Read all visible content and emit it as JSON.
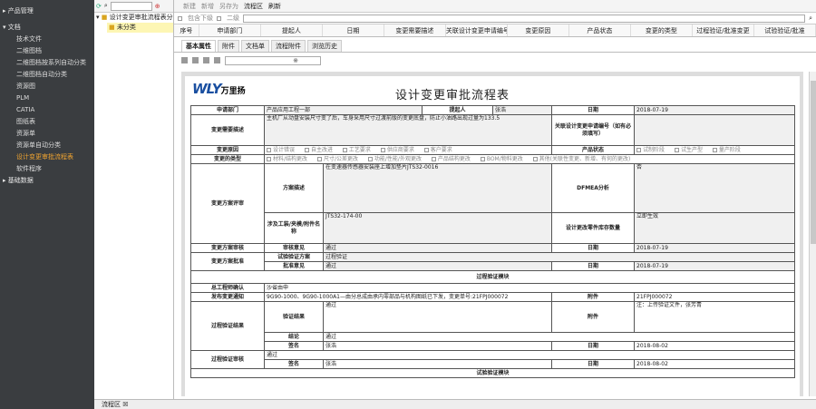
{
  "sidebar": {
    "items": [
      {
        "label": "▸ 产品管理"
      },
      {
        "label": "▾ 文档"
      },
      {
        "label": "技术文件"
      },
      {
        "label": "二维图档"
      },
      {
        "label": "二维图档按系列自动分类"
      },
      {
        "label": "二维图档自动分类"
      },
      {
        "label": "资源图"
      },
      {
        "label": "PLM"
      },
      {
        "label": "CATIA"
      },
      {
        "label": "图纸表"
      },
      {
        "label": "资源单"
      },
      {
        "label": "资源单自动分类"
      },
      {
        "label": "设计变更审批流程表"
      },
      {
        "label": "软件程序"
      },
      {
        "label": "▸ 基础数据"
      }
    ]
  },
  "tree": {
    "root": "设计变更审批流程表分类",
    "child": "未分类"
  },
  "topbar": {
    "items": [
      "新建",
      "新增",
      "另存为",
      "流程区",
      "刷新"
    ]
  },
  "filter": {
    "chk1": "包含下级",
    "chk2": "二级"
  },
  "columns": [
    "序号",
    "申请部门",
    "提起人",
    "日期",
    "变更需要描述",
    "关联设计变更申请编号",
    "变更原因",
    "产品状态",
    "变更的类型",
    "过程验证/批准变更",
    "试验验证/批准"
  ],
  "tabs": [
    "基本属性",
    "附件",
    "文档单",
    "流程附件",
    "浏览历史"
  ],
  "toolbar": {
    "select_value": "※"
  },
  "doc": {
    "logo": "WLY",
    "logo_cn": "万里扬",
    "title": "设计变更审批流程表",
    "r1": {
      "l1": "申请部门",
      "v1": "产品应用工程一部",
      "l2": "提起人",
      "v2": "张浩",
      "l3": "日期",
      "v3": "2018-07-19"
    },
    "r2": {
      "l1": "变更需要描述",
      "v1": "主机厂从动盘安装尺寸变了后，车身采用尺寸过渡前版的变更底盘，防止小油路出现过量为133.5",
      "l2": "关联设计变更申请编号（如有必须填写）",
      "v2": ""
    },
    "r3": {
      "l1": "变更原因",
      "opts": [
        "设计错误",
        "自主改进",
        "工艺要求",
        "供应商要求",
        "客户要求"
      ],
      "l2": "产品状态",
      "opts2": [
        "试制阶段",
        "试生产型",
        "量产阶段"
      ]
    },
    "r4": {
      "l1": "变更的类型",
      "opts": [
        "材料/结构更改",
        "尺寸/公差更改",
        "功能/性能/外观更改",
        "产品结构更改",
        "BOM/物料更改",
        "其他(关联性变更、新增、有何的更改)"
      ]
    },
    "r5": {
      "l1": "变更方案评审",
      "a": "方案描述",
      "av": "在变速器传感器安装座上增加垫片JTS32-0016",
      "b": "DFMEA分析",
      "bv": "否",
      "c": "涉及工装/夹模/附件名称",
      "cv": "JTS32-174-00",
      "d": "设计更改零件库存数量",
      "dv": "立即生效"
    },
    "r6": {
      "l1": "变更方案审核",
      "a": "审核意见",
      "av": "通过",
      "b": "日期",
      "bv": "2018-07-19"
    },
    "r7": {
      "l1": "变更方案批准",
      "a": "试验验证方案",
      "av": "过程验证",
      "b": "批准意见",
      "bv": "通过",
      "c": "日期",
      "cv": "2018-07-19"
    },
    "r8": {
      "text": "过程验证模块"
    },
    "r9": {
      "l1": "总工程师确认",
      "v1": "沙省由申"
    },
    "r10": {
      "l1": "发布变更通知",
      "v1": "9G90-1000、9G90-1000A1—由分总成由承内零部品与机构图纸已下发，变更单号:21FPJ000072",
      "l2": "附件",
      "v2": "21FPJ000072"
    },
    "r11": {
      "l1": "过程验证结果",
      "a": "验证结果",
      "av": "通过",
      "b": "附件",
      "bv": "注：上传验证文件，张芳青"
    },
    "r12": {
      "a": "结论",
      "av": "通过",
      "b": "签名",
      "bv": "张浩",
      "c": "日期",
      "cv": "2018-08-02"
    },
    "r13": {
      "l1": "过程验证审核",
      "v1": "通过",
      "a": "签名",
      "av": "张浩",
      "b": "日期",
      "bv": "2018-08-02"
    },
    "r14": {
      "text": "试验验证模块"
    }
  },
  "bottom": {
    "tab": "流程区 ☒"
  }
}
